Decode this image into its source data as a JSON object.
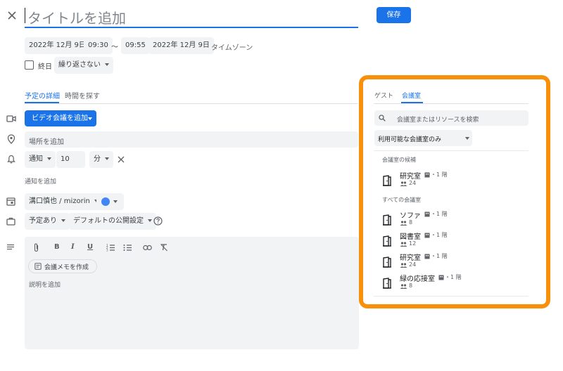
{
  "header": {
    "title_placeholder": "タイトルを追加",
    "save_label": "保存"
  },
  "datetime": {
    "start_date": "2022年 12月 9日",
    "start_time": "09:30",
    "separator": "〜",
    "end_time": "09:55",
    "end_date": "2022年 12月 9日",
    "timezone": "タイムゾーン",
    "allday_label": "終日",
    "repeat_label": "繰り返さない"
  },
  "tabs": {
    "details": "予定の詳細",
    "find_time": "時間を探す"
  },
  "details": {
    "video_button": "ビデオ会議を追加",
    "location_placeholder": "場所を追加",
    "notify_type": "通知",
    "notify_value": "10",
    "notify_unit": "分",
    "add_notification": "通知を追加",
    "calendar_owner": "溝口慎也 / mizorin",
    "availability": "予定あり",
    "visibility": "デフォルトの公開設定",
    "meeting_notes": "会議メモを作成",
    "description_placeholder": "説明を追加"
  },
  "colors": {
    "accent": "#1a73e8",
    "highlight_border": "#f9900a",
    "event_color": "#4285f4"
  },
  "rooms_panel": {
    "tabs": {
      "guests": "ゲスト",
      "rooms": "会議室"
    },
    "search_placeholder": "会議室またはリソースを検索",
    "filter": "利用可能な会議室のみ",
    "suggested_label": "会議室の候補",
    "all_label": "すべての会議室",
    "suggested": [
      {
        "name": "研究室",
        "floor": "・1 階",
        "capacity": "24"
      }
    ],
    "all": [
      {
        "name": "ソファ",
        "floor": "・1 階",
        "capacity": "8"
      },
      {
        "name": "図書室",
        "floor": "・1 階",
        "capacity": "12"
      },
      {
        "name": "研究室",
        "floor": "・1 階",
        "capacity": "24"
      },
      {
        "name": "緑の応接室",
        "floor": "・1 階",
        "capacity": "8"
      }
    ]
  },
  "icons": [
    "close-icon",
    "video-icon",
    "location-icon",
    "bell-icon",
    "calendar-icon",
    "briefcase-icon",
    "description-icon",
    "search-icon",
    "room-icon",
    "people-icon",
    "building-icon",
    "attach-icon",
    "bold-icon",
    "italic-icon",
    "underline-icon",
    "numbered-list-icon",
    "bullet-list-icon",
    "link-icon",
    "clear-format-icon",
    "help-icon",
    "notes-icon"
  ]
}
